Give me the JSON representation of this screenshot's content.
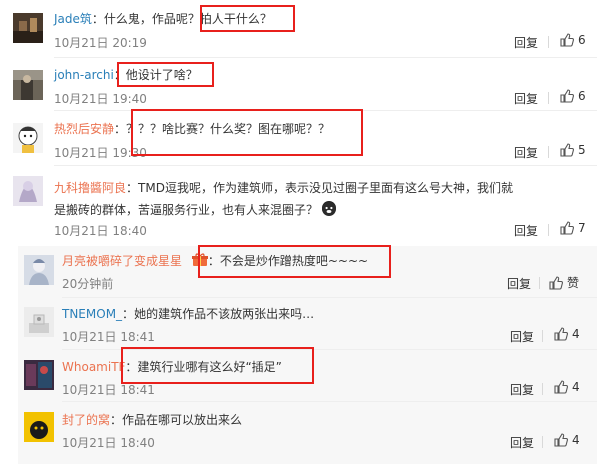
{
  "comments": [
    {
      "user": "Jade筑",
      "sep": "：",
      "text": "什么鬼，作品呢？拍人干什么？",
      "time": "10月21日 20:19",
      "reply": "回复",
      "likes": "6"
    },
    {
      "user": "john-archi",
      "sep": "：",
      "text": "他设计了啥？",
      "time": "10月21日 19:40",
      "reply": "回复",
      "likes": "6"
    },
    {
      "user": "热烈后安静",
      "sep": "：",
      "text": "？？？啥比赛？什么奖？图在哪呢？？",
      "time": "10月21日 19:30",
      "reply": "回复",
      "likes": "5"
    },
    {
      "user": "九科撸醬阿良",
      "sep": "：",
      "text": "TMD逗我呢，作为建筑师，表示没见过圈子里面有这么号大神，我们就是搬砖的群体，苦逼服务行业，也有人来混圈子？",
      "time": "10月21日 18:40",
      "reply": "回复",
      "likes": "7"
    }
  ],
  "replies": [
    {
      "user": "月亮被嚼碎了变成星星",
      "sep": "：",
      "text": "不会是炒作蹭热度吧~~~~",
      "time": "20分钟前",
      "reply": "回复",
      "likes": "赞"
    },
    {
      "user": "TNEMOM_",
      "sep": "：",
      "text": "她的建筑作品不该放两张出来吗…",
      "time": "10月21日 18:41",
      "reply": "回复",
      "likes": "4"
    },
    {
      "user": "WhoamiTF",
      "sep": "：",
      "text": "建筑行业哪有这么好“插足”",
      "time": "10月21日 18:41",
      "reply": "回复",
      "likes": "4"
    },
    {
      "user": "封了的窝",
      "sep": "：",
      "text": "作品在哪可以放出来么",
      "time": "10月21日 18:40",
      "reply": "回复",
      "likes": "4"
    }
  ],
  "colors": {
    "username": "#eb7350",
    "username_link": "#2a7fb8",
    "highlight_box": "#e8201c",
    "time": "#808080"
  },
  "icons": {
    "like": "thumbs-up-icon",
    "emoji": "pig-face-emoji-icon",
    "badge": "gift-badge-icon"
  }
}
